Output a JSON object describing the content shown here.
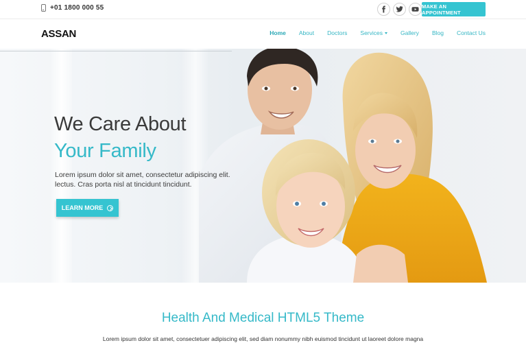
{
  "topbar": {
    "phone": "+01 1800 000 55",
    "socials": [
      "facebook-icon",
      "twitter-icon",
      "youtube-icon"
    ],
    "appointment_label": "MAKE AN APPOINTMENT"
  },
  "header": {
    "logo": "ASSAN",
    "nav": [
      {
        "label": "Home",
        "active": true
      },
      {
        "label": "About"
      },
      {
        "label": "Doctors"
      },
      {
        "label": "Services",
        "dropdown": true
      },
      {
        "label": "Gallery"
      },
      {
        "label": "Blog"
      },
      {
        "label": "Contact Us"
      }
    ]
  },
  "hero": {
    "title_line1": "We Care About",
    "title_line2": "Your Family",
    "description": "Lorem ipsum dolor sit amet, consectetur adipiscing elit. lectus. Cras porta nisl at tincidunt tincidunt.",
    "button_label": "LEARN MORE"
  },
  "section": {
    "title": "Health And Medical HTML5 Theme",
    "text": "Lorem ipsum dolor sit amet, consectetuer adipiscing elit, sed diam nonummy nibh euismod tincidunt ut laoreet dolore magna"
  },
  "colors": {
    "accent": "#35c4d1",
    "nav_text": "#35b6c4",
    "heading_dark": "#3a3a3a"
  }
}
